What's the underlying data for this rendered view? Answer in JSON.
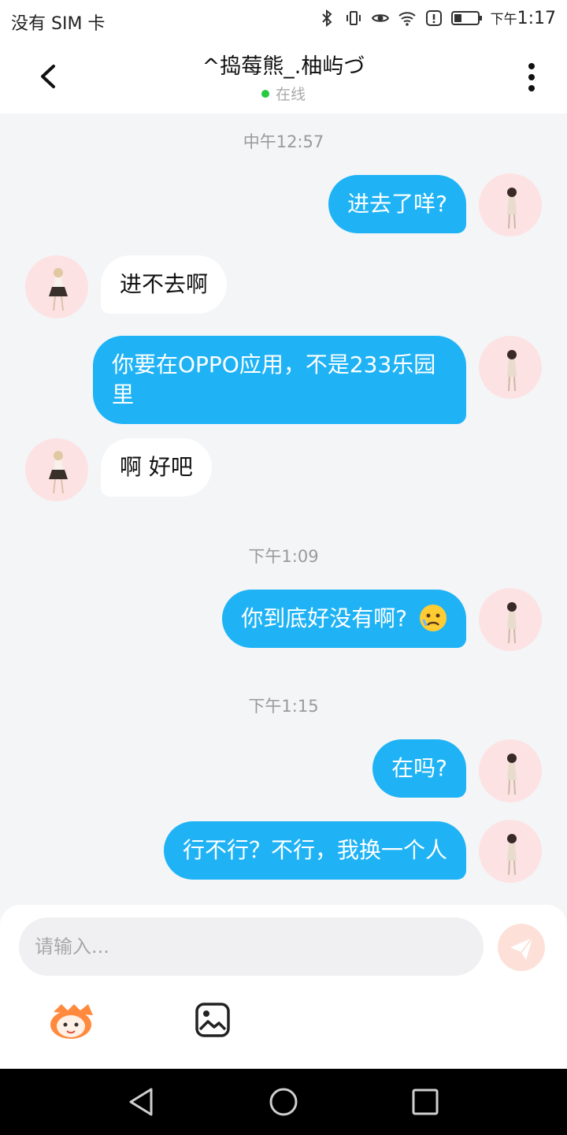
{
  "status_bar": {
    "carrier": "没有 SIM 卡",
    "time_prefix": "下午",
    "time": "1:17",
    "icons": [
      "bluetooth-icon",
      "vibrate-icon",
      "eye-icon",
      "wifi-icon",
      "alert-icon",
      "battery-icon"
    ]
  },
  "header": {
    "title": "^捣莓熊_.柚屿づ",
    "presence": "在线",
    "presence_color": "#27c93f"
  },
  "messages": {
    "ts1": "中午12:57",
    "m1": "进去了咩?",
    "m2": "进不去啊",
    "m3": "你要在OPPO应用，不是233乐园里",
    "m4": "啊 好吧",
    "ts2": "下午1:09",
    "m5": "你到底好没有啊?",
    "m5_emoji": "😥",
    "ts3": "下午1:15",
    "m6": "在吗?",
    "m7": "行不行？不行，我换一个人"
  },
  "input": {
    "placeholder": "请输入..."
  },
  "colors": {
    "outgoing_bubble": "#1fb3f6",
    "incoming_bubble": "#ffffff",
    "background": "#f4f5f7",
    "send_button": "#fde1d9"
  }
}
